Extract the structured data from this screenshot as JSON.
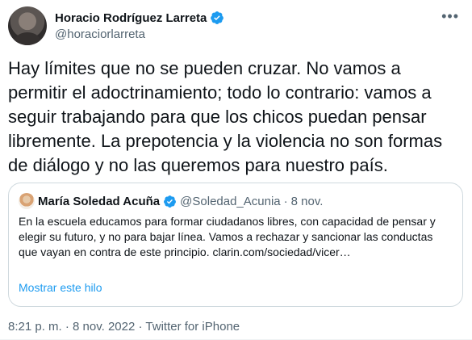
{
  "author": {
    "display_name": "Horacio Rodríguez Larreta",
    "handle": "@horaciorlarreta",
    "avatar_icon": "profile-photo",
    "verified_icon": "verified-badge-icon",
    "more_icon": "more-options-icon"
  },
  "tweet_text": "Hay límites que no se pueden cruzar. No vamos a permitir el adoctrinamiento; todo lo contrario: vamos a seguir trabajando para que los chicos puedan pensar libremente. La prepotencia y la violencia no son formas de diálogo y no las queremos para nuestro país.",
  "quoted": {
    "display_name": "María Soledad Acuña",
    "handle": "@Soledad_Acunia",
    "separator": "·",
    "date": "8 nov.",
    "text": "En la escuela educamos para formar ciudadanos libres, con capacidad de pensar y elegir su futuro, y no para bajar línea. Vamos a rechazar y sancionar las conductas que vayan en contra de este principio. clarin.com/sociedad/vicer…",
    "show_thread": "Mostrar este hilo"
  },
  "meta": {
    "time": "8:21 p. m.",
    "separator1": " · ",
    "date": "8 nov. 2022",
    "separator2": " · ",
    "source": "Twitter for iPhone"
  },
  "colors": {
    "verified": "#1d9bf0",
    "link": "#1d9bf0",
    "secondary_text": "#536471",
    "border": "#cfd9de"
  }
}
